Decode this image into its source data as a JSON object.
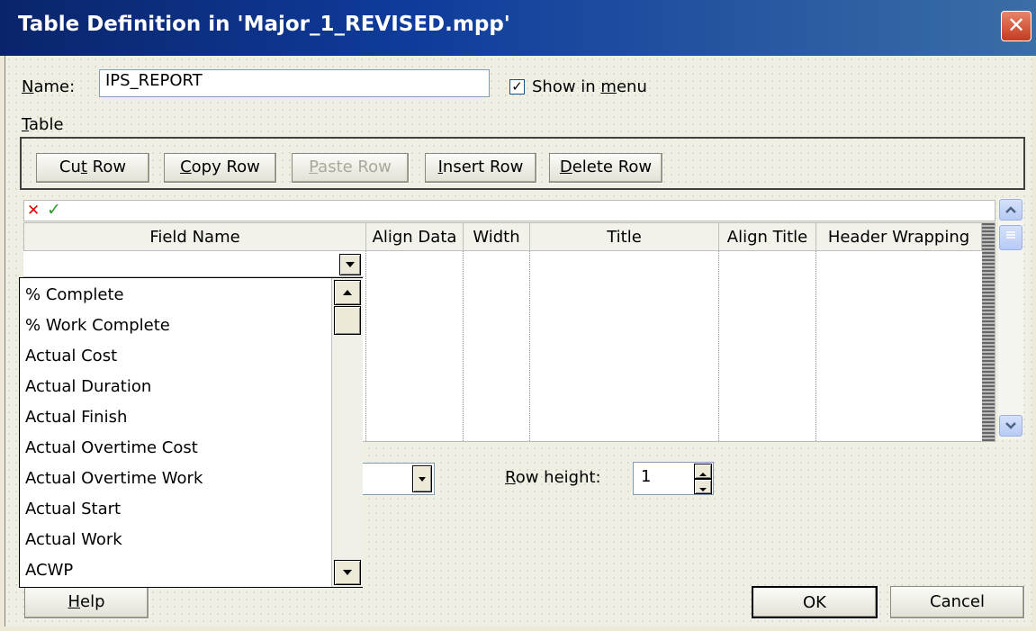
{
  "window": {
    "title": "Table Definition in 'Major_1_REVISED.mpp'",
    "close_glyph": "✕"
  },
  "name_field": {
    "label_accel": "N",
    "label_rest": "ame:",
    "value": "IPS_REPORT"
  },
  "show_in_menu": {
    "checked_glyph": "✓",
    "label_pre": "Show in ",
    "label_accel": "m",
    "label_post": "enu"
  },
  "table_group": {
    "label_accel": "T",
    "label_rest": "able"
  },
  "toolbar": {
    "cut": {
      "pre": "Cu",
      "accel": "t",
      "post": " Row"
    },
    "copy": {
      "pre": "",
      "accel": "C",
      "post": "opy Row"
    },
    "paste": {
      "pre": "",
      "accel": "P",
      "post": "aste Row"
    },
    "insert": {
      "pre": "",
      "accel": "I",
      "post": "nsert Row"
    },
    "delete": {
      "pre": "",
      "accel": "D",
      "post": "elete Row"
    }
  },
  "edit_bar": {
    "cancel_glyph": "✕",
    "accept_glyph": "✓"
  },
  "grid": {
    "columns": [
      "Field Name",
      "Align Data",
      "Width",
      "Title",
      "Align Title",
      "Header Wrapping"
    ]
  },
  "field_dropdown": {
    "items": [
      "% Complete",
      "% Work Complete",
      "Actual Cost",
      "Actual Duration",
      "Actual Finish",
      "Actual Overtime Cost",
      "Actual Overtime Work",
      "Actual Start",
      "Actual Work",
      "ACWP"
    ]
  },
  "row_height": {
    "label_accel": "R",
    "label_rest": "ow height:",
    "value": "1"
  },
  "buttons": {
    "help": {
      "accel": "H",
      "rest": "elp"
    },
    "ok": "OK",
    "cancel": "Cancel"
  },
  "colors": {
    "titlebar": "#0a246a",
    "close": "#d9593a",
    "accept_check": "#2a9d2a",
    "cancel_x": "#e00000"
  }
}
